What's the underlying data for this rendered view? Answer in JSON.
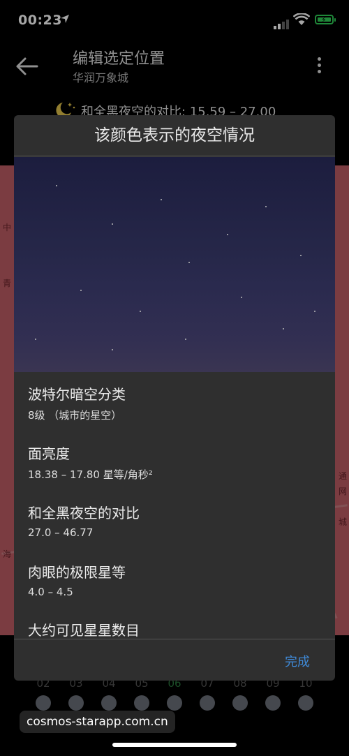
{
  "status": {
    "time": "00:23"
  },
  "header": {
    "title": "编辑选定位置",
    "subtitle": "华润万象城",
    "contrast": "和全黑夜空的对比:  15.59 – 27.00"
  },
  "dialog": {
    "title": "该颜色表示的夜空情况",
    "items": [
      {
        "heading": "波特尔暗空分类",
        "value": "8级 （城市的星空）"
      },
      {
        "heading": "面亮度",
        "value": "18.38 – 17.80 星等/角秒²"
      },
      {
        "heading": "和全黑夜空的对比",
        "value": "27.0 – 46.77"
      },
      {
        "heading": "肉眼的极限星等",
        "value": "4.0 – 4.5"
      },
      {
        "heading": "大约可见星星数目",
        "value": ""
      }
    ],
    "done_label": "完成"
  },
  "map_labels": [
    "中",
    "青",
    "通",
    "网",
    "城",
    "海"
  ],
  "date_strip": [
    "02",
    "03",
    "04",
    "05",
    "06",
    "07",
    "08",
    "09",
    "10"
  ],
  "watermark": "cosmos-starapp.com.cn",
  "colors": {
    "accent": "#3f8ad8",
    "map": "#d96a72",
    "battery": "#31d158"
  }
}
